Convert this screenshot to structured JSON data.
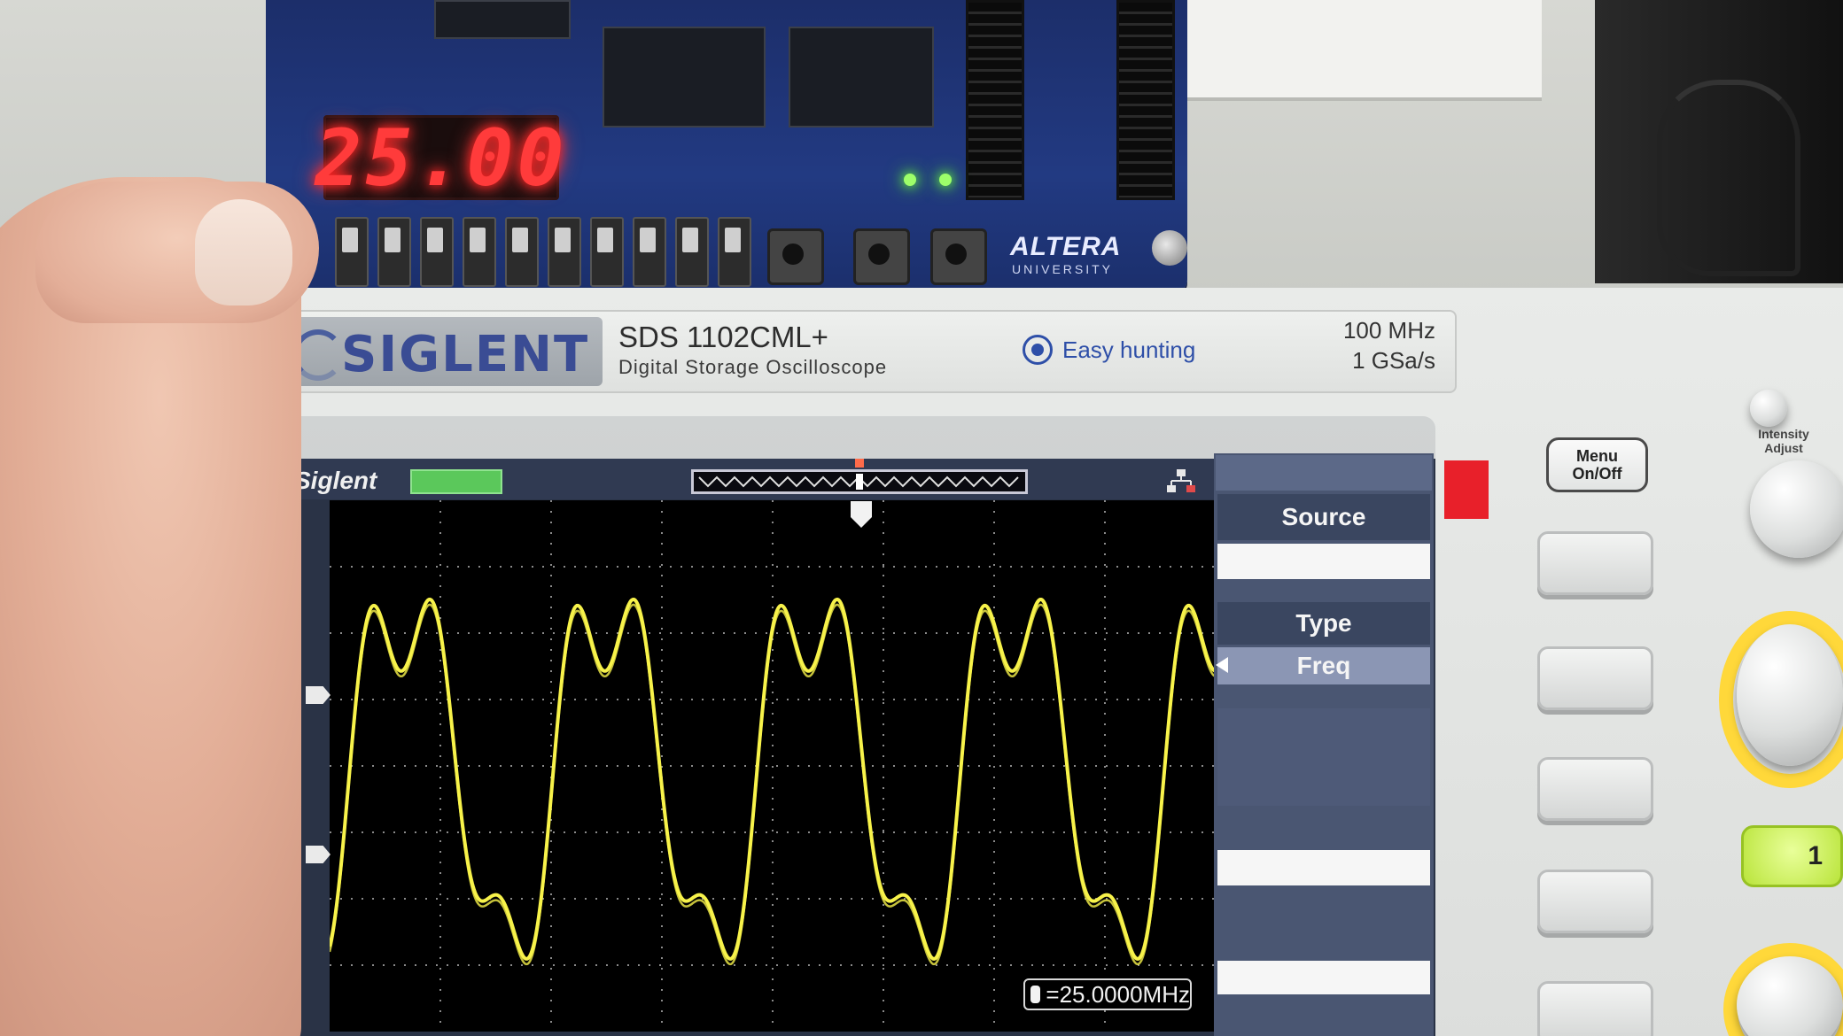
{
  "fpga_board": {
    "seven_segment_display": "25.00",
    "brand": "ALTERA",
    "brand_sub": "UNIVERSITY"
  },
  "oscilloscope": {
    "brand": "SIGLENT",
    "model": "SDS 1102CML+",
    "model_subtitle": "Digital Storage Oscilloscope",
    "feature": "Easy hunting",
    "bandwidth": "100 MHz",
    "sample_rate": "1 GSa/s",
    "screen": {
      "brand_label": "Siglent",
      "menu": {
        "source_label": "Source",
        "type_label": "Type",
        "type_value": "Freq"
      },
      "measurement_readout": "=25.0000MHz",
      "waveform_color": "#f7f24a"
    },
    "buttons": {
      "menu_onoff": "Menu\nOn/Off",
      "intensity_adjust": "Intensity\nAdjust",
      "channel_1": "1"
    }
  },
  "colors": {
    "segment_red": "#ff3b3b",
    "siglent_blue": "#3a4c94",
    "trace_yellow": "#f7f24a",
    "screen_background": "#000000",
    "menu_panel": "#4a5672"
  }
}
